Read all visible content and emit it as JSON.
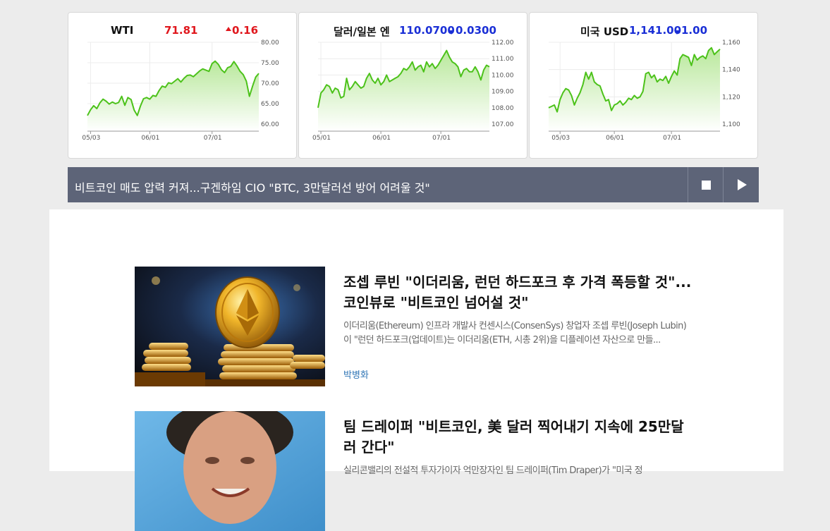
{
  "markets": [
    {
      "name": "WTI",
      "price": "71.81",
      "change": "0.16",
      "direction": "up",
      "price_color": "#e0171d",
      "change_color": "#e0171d",
      "y_ticks": [
        "80.00",
        "75.00",
        "70.00",
        "65.00",
        "60.00"
      ],
      "y_values": [
        80,
        75,
        70,
        65,
        60
      ],
      "x_ticks": [
        "05/03",
        "06/01",
        "07/01"
      ],
      "x_tick_index": [
        1,
        20,
        40
      ],
      "series": [
        62.1,
        63.5,
        64.5,
        63.8,
        65.2,
        66.1,
        65.6,
        64.9,
        65.4,
        65.0,
        65.3,
        66.8,
        64.6,
        66.5,
        66.0,
        63.4,
        62.1,
        64.4,
        66.2,
        66.5,
        66.1,
        67.0,
        66.8,
        68.2,
        69.3,
        69.0,
        70.1,
        69.9,
        70.5,
        71.1,
        70.3,
        71.2,
        71.9,
        72.0,
        71.6,
        72.3,
        73.0,
        73.5,
        73.2,
        72.9,
        74.8,
        75.4,
        74.6,
        73.3,
        72.6,
        73.8,
        74.1,
        75.3,
        74.2,
        72.9,
        72.1,
        70.5,
        66.8,
        69.3,
        71.5,
        72.4
      ]
    },
    {
      "name": "달러/일본 엔",
      "price": "110.0700",
      "change": "0.0300",
      "direction": "down",
      "price_color": "#1a2fd6",
      "change_color": "#1a2fd6",
      "y_ticks": [
        "112.00",
        "111.00",
        "110.00",
        "109.00",
        "108.00",
        "107.00"
      ],
      "y_values": [
        112,
        111,
        110,
        109,
        108,
        107
      ],
      "x_ticks": [
        "05/01",
        "06/01",
        "07/01"
      ],
      "x_tick_index": [
        1,
        22,
        43
      ],
      "series": [
        108.0,
        108.9,
        109.1,
        109.4,
        109.3,
        108.9,
        109.2,
        109.1,
        108.6,
        108.7,
        109.8,
        109.1,
        109.3,
        109.6,
        109.4,
        109.2,
        109.3,
        109.8,
        110.1,
        109.7,
        109.5,
        109.8,
        109.4,
        109.6,
        110.0,
        109.6,
        109.7,
        109.8,
        109.9,
        110.1,
        110.4,
        110.3,
        110.5,
        110.8,
        110.3,
        110.5,
        110.6,
        110.2,
        110.8,
        110.5,
        110.7,
        110.4,
        110.6,
        110.9,
        111.2,
        111.5,
        111.1,
        110.8,
        110.7,
        110.5,
        109.9,
        110.3,
        110.4,
        110.2,
        110.2,
        110.5,
        110.2,
        109.7,
        110.3,
        110.6,
        110.5
      ]
    },
    {
      "name": "미국 USD",
      "price": "1,141.00",
      "change": "1.00",
      "direction": "down",
      "price_color": "#1a2fd6",
      "change_color": "#1a2fd6",
      "y_ticks": [
        "1,160",
        "1,140",
        "1,120",
        "1,100"
      ],
      "y_values": [
        1160,
        1140,
        1120,
        1100
      ],
      "x_ticks": [
        "05/03",
        "06/01",
        "07/01"
      ],
      "x_tick_index": [
        4,
        23,
        43
      ],
      "series": [
        1112,
        1113,
        1114,
        1109,
        1118,
        1123,
        1126,
        1125,
        1121,
        1114,
        1119,
        1123,
        1129,
        1138,
        1133,
        1138,
        1131,
        1129,
        1128,
        1122,
        1117,
        1118,
        1110,
        1114,
        1115,
        1117,
        1114,
        1116,
        1119,
        1118,
        1121,
        1119,
        1120,
        1124,
        1137,
        1138,
        1134,
        1136,
        1131,
        1133,
        1132,
        1135,
        1130,
        1135,
        1139,
        1136,
        1148,
        1151,
        1150,
        1149,
        1143,
        1151,
        1147,
        1149,
        1150,
        1148,
        1154,
        1156,
        1151,
        1153,
        1155
      ]
    }
  ],
  "ticker": {
    "headline": "비트코인 매도 압력 커져...구겐하임 CIO \"BTC, 3만달러선 방어 어려울 것\"",
    "stop_icon": "stop-icon",
    "play_icon": "play-icon"
  },
  "articles": [
    {
      "title": "조셉 루빈 \"이더리움, 런던 하드포크 후 가격 폭등할 것\"...코인뷰로 \"비트코인 넘어설 것\"",
      "summary": "이더리움(Ethereum) 인프라 개발사 컨센시스(ConsenSys) 창업자 조셉 루빈(Joseph Lubin)이 \"런던 하드포크(업데이트)는 이더리움(ETH, 시총 2위)을 디플레이션 자산으로 만들...",
      "author": "박병화"
    },
    {
      "title": "팀 드레이퍼 \"비트코인, 美 달러 찍어내기 지속에 25만달러 간다\"",
      "summary": "실리콘밸리의 전설적 투자가이자 억만장자인 팀 드레이퍼(Tim Draper)가 \"미국 정",
      "author": ""
    }
  ]
}
